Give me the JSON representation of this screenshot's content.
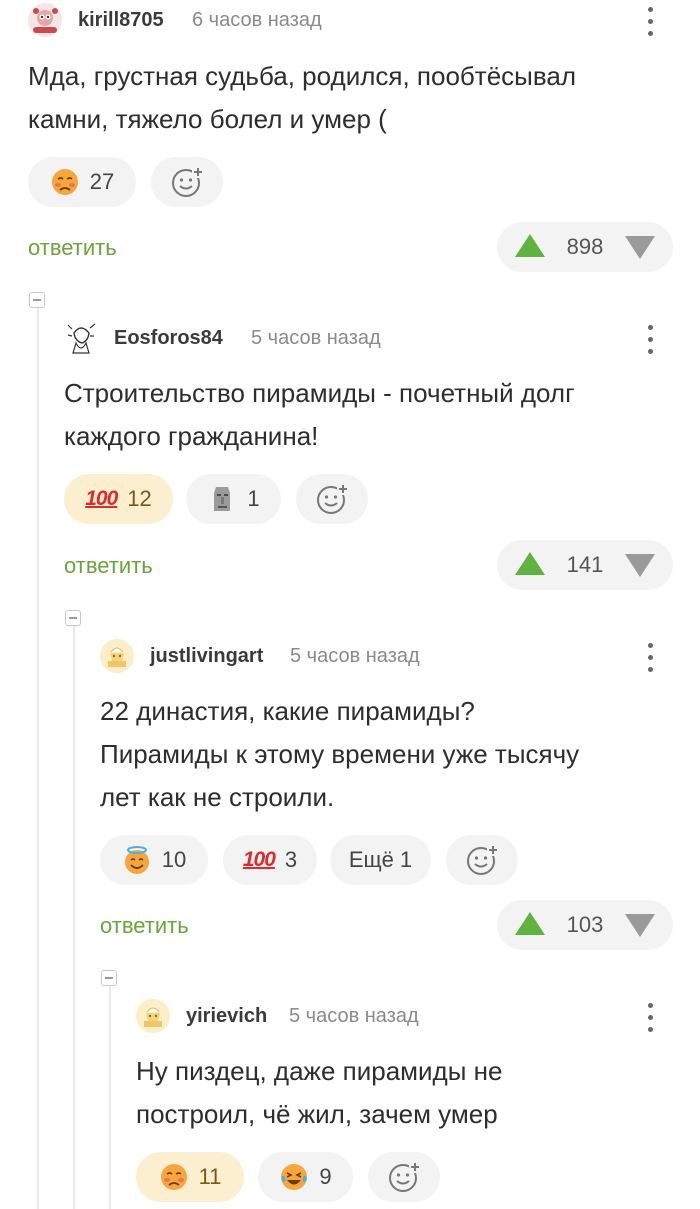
{
  "colors": {
    "accent_green": "#6aa33a",
    "upvote": "#5fb33f",
    "pill_bg": "#f3f3f3",
    "pill_active_bg": "#fbefcf"
  },
  "comments": [
    {
      "username": "kirill8705",
      "time": "6 часов назад",
      "text_lines": [
        "Мда, грустная судьба, родился, пообтёсывал",
        "камни, тяжело болел и умер ("
      ],
      "reactions": [
        {
          "icon": "sad-face-icon",
          "count": "27",
          "active": false
        }
      ],
      "reply_label": "ответить",
      "rating": "898"
    },
    {
      "username": "Eosforos84",
      "time": "5 часов назад",
      "text_lines": [
        "Строительство пирамиды - почетный долг",
        "каждого гражданина!"
      ],
      "reactions": [
        {
          "icon": "hundred-points-icon",
          "label": "100",
          "count": "12",
          "active": true
        },
        {
          "icon": "moai-icon",
          "count": "1",
          "active": false
        }
      ],
      "reply_label": "ответить",
      "rating": "141"
    },
    {
      "username": "justlivingart",
      "time": "5 часов назад",
      "text_lines": [
        "22 династия, какие пирамиды?",
        "Пирамиды к этому времени уже тысячу",
        "лет как не строили."
      ],
      "reactions": [
        {
          "icon": "halo-smile-icon",
          "count": "10",
          "active": false
        },
        {
          "icon": "hundred-points-icon",
          "label": "100",
          "count": "3",
          "active": false
        }
      ],
      "more_label": "Ещё 1",
      "reply_label": "ответить",
      "rating": "103"
    },
    {
      "username": "yirievich",
      "time": "5 часов назад",
      "text_lines": [
        "Ну пиздец, даже пирамиды не",
        "построил, чё жил, зачем умер"
      ],
      "reactions": [
        {
          "icon": "sad-face-icon",
          "count": "11",
          "active": true
        },
        {
          "icon": "tears-of-joy-icon",
          "count": "9",
          "active": false
        }
      ]
    }
  ]
}
